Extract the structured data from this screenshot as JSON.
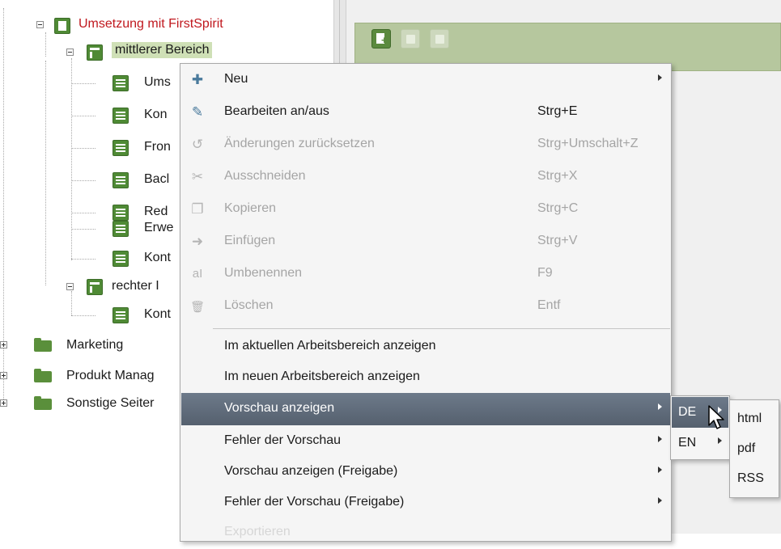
{
  "tree": {
    "items": [
      {
        "label": "Umsetzung mit FirstSpirit",
        "icon": "page-store-icon",
        "color": "#c0181e"
      },
      {
        "label": "mittlerer Bereich",
        "icon": "section-icon",
        "selected": true
      },
      {
        "label": "Ums",
        "icon": "page-icon"
      },
      {
        "label": "Kon",
        "icon": "page-icon"
      },
      {
        "label": "Fron",
        "icon": "page-icon"
      },
      {
        "label": "Bacl",
        "icon": "page-icon"
      },
      {
        "label": "Red",
        "icon": "page-icon"
      },
      {
        "label": "Erwe",
        "icon": "page-icon"
      },
      {
        "label": "Kont",
        "icon": "page-icon"
      },
      {
        "label": "rechter I",
        "icon": "section-icon"
      },
      {
        "label": "Kont",
        "icon": "page-icon"
      },
      {
        "label": "Marketing",
        "icon": "folder-icon"
      },
      {
        "label": "Produkt Manag",
        "icon": "folder-icon"
      },
      {
        "label": "Sonstige Seiter",
        "icon": "folder-icon"
      }
    ]
  },
  "toolbar": {
    "buttons": [
      {
        "icon": "new-page-icon",
        "enabled": true
      },
      {
        "icon": "image-icon",
        "enabled": false
      },
      {
        "icon": "trash-icon",
        "enabled": false
      }
    ],
    "accent": "#b6c79e"
  },
  "context_menu": {
    "items": [
      {
        "label": "Neu",
        "shortcut": "",
        "icon": "new-icon",
        "glyph": "✚",
        "submenu": true,
        "disabled": false
      },
      {
        "label": "Bearbeiten an/aus",
        "shortcut": "Strg+E",
        "icon": "edit-icon",
        "glyph": "✎",
        "disabled": false
      },
      {
        "label": "Änderungen zurücksetzen",
        "shortcut": "Strg+Umschalt+Z",
        "icon": "undo-icon",
        "glyph": "↺",
        "disabled": true
      },
      {
        "label": "Ausschneiden",
        "shortcut": "Strg+X",
        "icon": "scissors-icon",
        "glyph": "✂",
        "disabled": true
      },
      {
        "label": "Kopieren",
        "shortcut": "Strg+C",
        "icon": "copy-icon",
        "glyph": "❐",
        "disabled": true
      },
      {
        "label": "Einfügen",
        "shortcut": "Strg+V",
        "icon": "paste-icon",
        "glyph": "➜",
        "disabled": true
      },
      {
        "label": "Umbenennen",
        "shortcut": "F9",
        "icon": "rename-icon",
        "glyph": "aI",
        "disabled": true
      },
      {
        "label": "Löschen",
        "shortcut": "Entf",
        "icon": "delete-icon",
        "glyph": "🗑",
        "disabled": true
      },
      {
        "label": "Im aktuellen Arbeitsbereich anzeigen",
        "shortcut": "",
        "disabled": false
      },
      {
        "label": "Im neuen Arbeitsbereich anzeigen",
        "shortcut": "",
        "disabled": false
      },
      {
        "label": "Vorschau anzeigen",
        "shortcut": "",
        "submenu": true,
        "highlight": true
      },
      {
        "label": "Fehler der Vorschau",
        "shortcut": "",
        "submenu": true
      },
      {
        "label": "Vorschau anzeigen (Freigabe)",
        "shortcut": "",
        "submenu": true
      },
      {
        "label": "Fehler der Vorschau (Freigabe)",
        "shortcut": "",
        "submenu": true
      },
      {
        "label": "Exportieren",
        "shortcut": "",
        "faded": true
      }
    ]
  },
  "language_submenu": {
    "items": [
      {
        "label": "DE",
        "highlight": true
      },
      {
        "label": "EN"
      }
    ]
  },
  "format_submenu": {
    "items": [
      {
        "label": "html"
      },
      {
        "label": "pdf"
      },
      {
        "label": "RSS"
      }
    ]
  }
}
